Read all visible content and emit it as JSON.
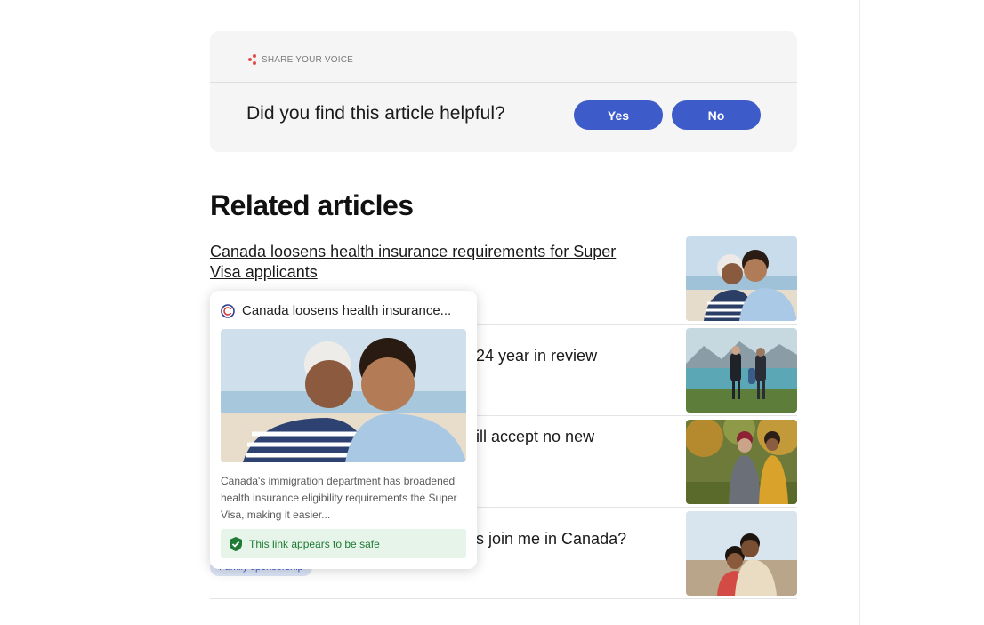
{
  "feedback": {
    "eyebrow": "SHARE YOUR VOICE",
    "question": "Did you find this article helpful?",
    "yes_label": "Yes",
    "no_label": "No"
  },
  "related": {
    "title": "Related articles",
    "articles": [
      {
        "title": "Canada loosens health insurance requirements for Super Visa applicants",
        "thumbnail": "grandmother-grandson-beach-photo"
      },
      {
        "title_visible_fragment": "24 year in review",
        "thumbnail": "family-mountain-lake-photo"
      },
      {
        "title_visible_fragment": "ill accept no new",
        "thumbnail": "mother-daughter-autumn-park-photo"
      },
      {
        "title_visible_fragment": "s join me in Canada?",
        "tag": "Family sponsorship",
        "thumbnail": "couple-coast-photo"
      }
    ]
  },
  "link_preview": {
    "site_icon": "site-logo-icon",
    "title": "Canada loosens health insurance...",
    "description": "Canada's immigration department has broadened health insurance eligibility requirements the Super Visa, making it easier...",
    "safety_text": "This link appears to be safe",
    "safety_icon": "shield-check-icon"
  },
  "colors": {
    "accent": "#3d5bc9",
    "safe_bg": "#e6f4ea",
    "safe_text": "#1e7a34"
  }
}
